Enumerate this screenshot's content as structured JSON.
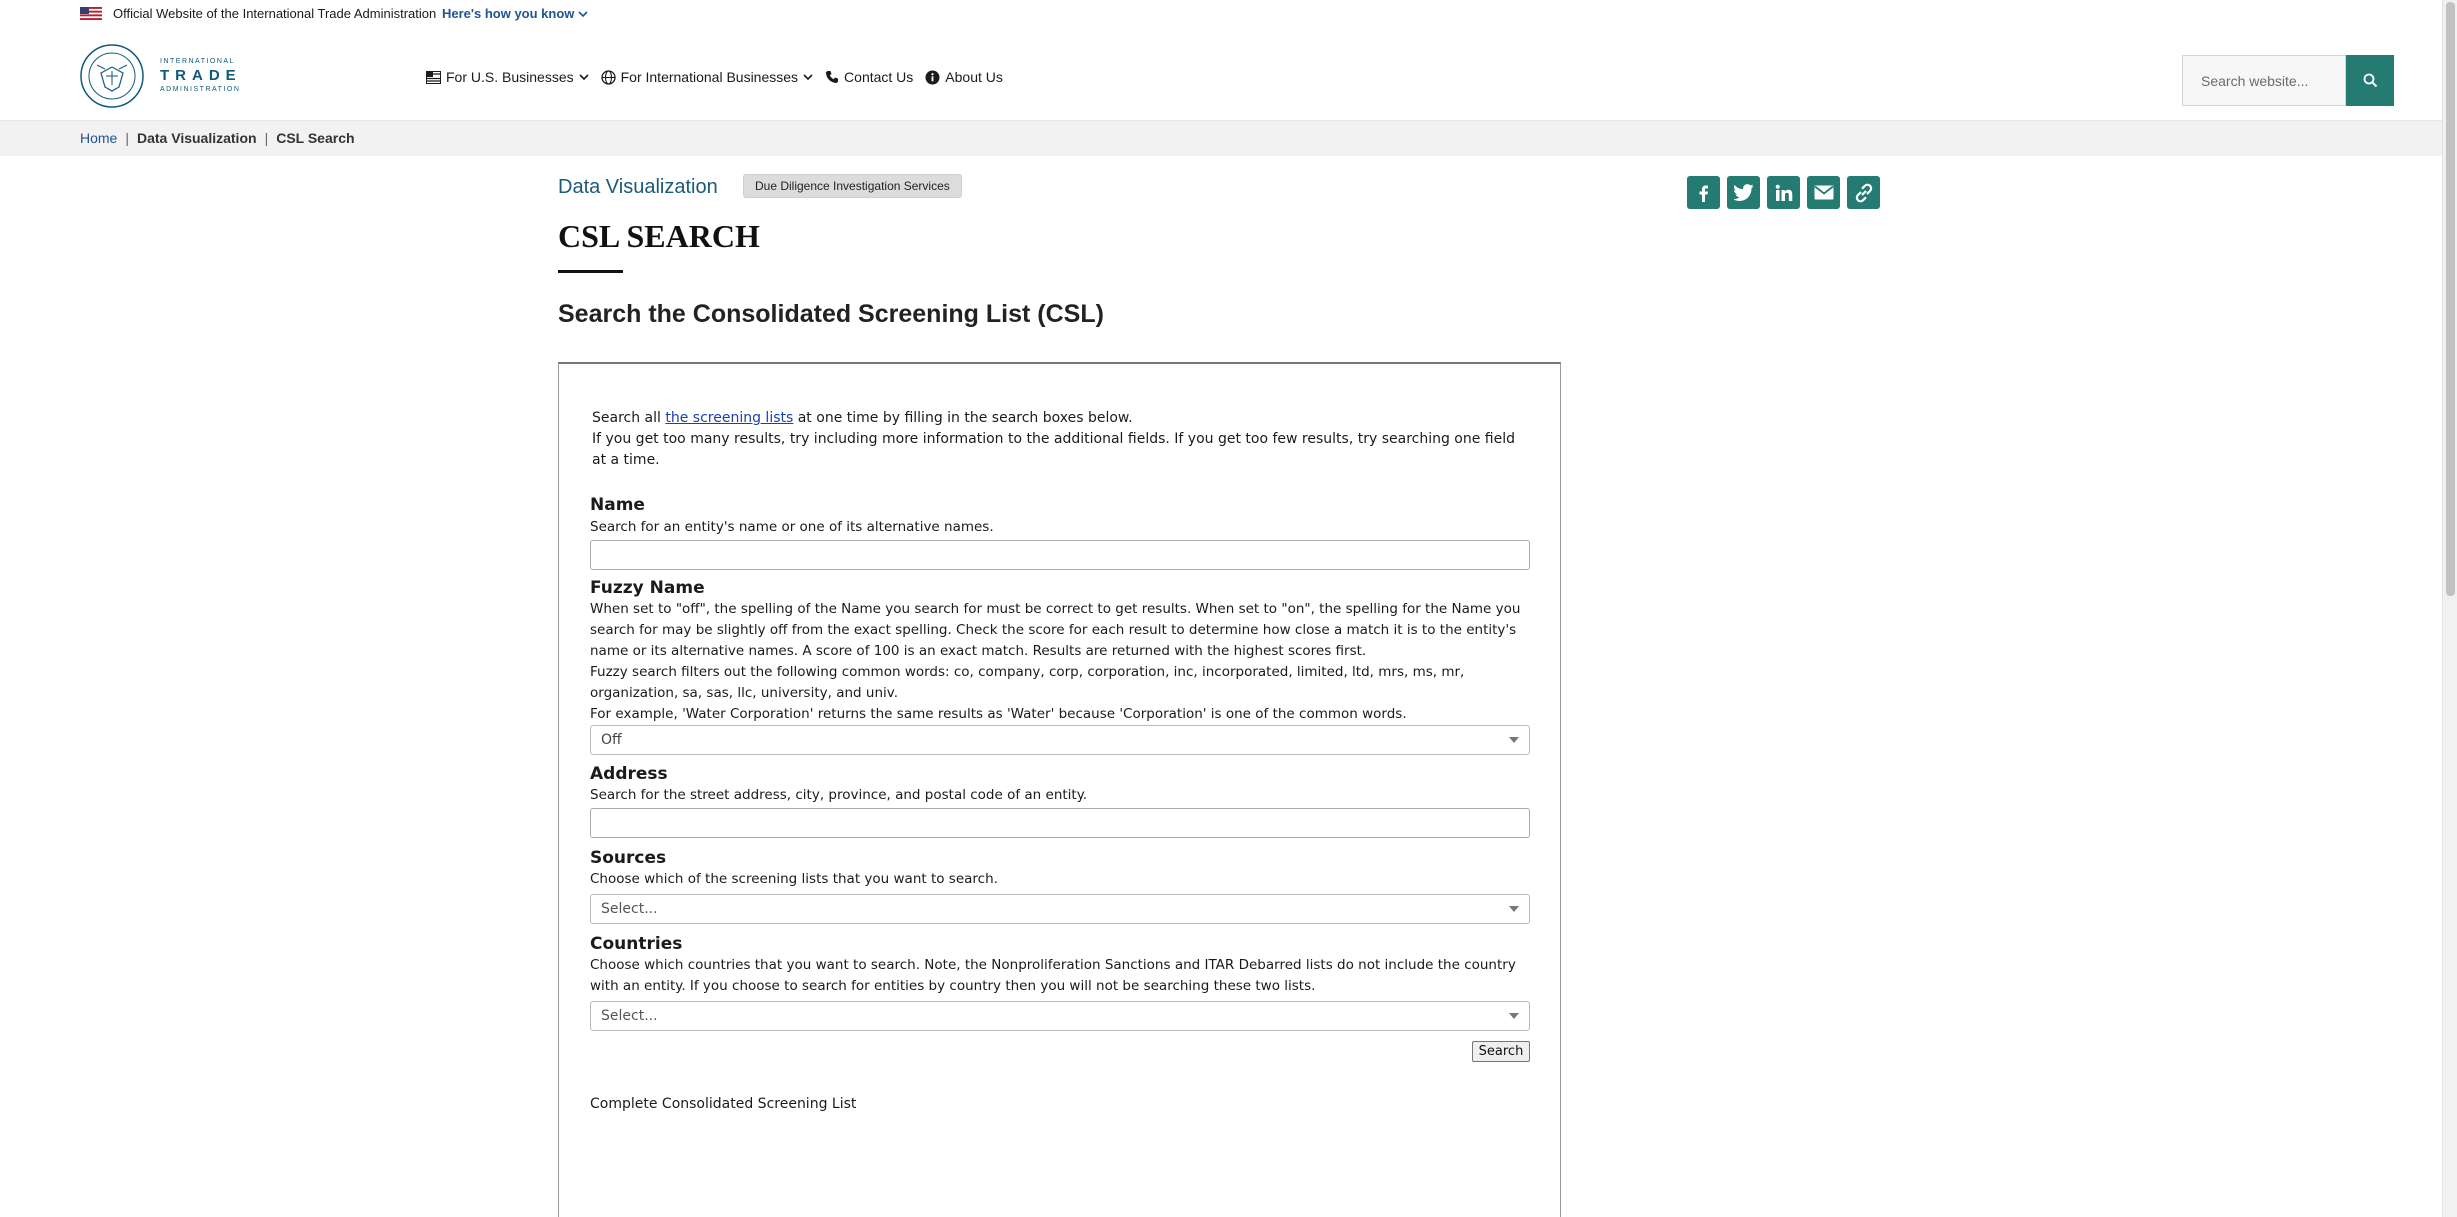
{
  "banner": {
    "official_text": "Official Website of the International Trade Administration",
    "how_you_know": "Here's how you know"
  },
  "logo": {
    "line1": "INTERNATIONAL",
    "line2": "TRADE",
    "line3": "ADMINISTRATION"
  },
  "nav": {
    "items": [
      {
        "label": "For U.S. Businesses",
        "icon": "flag-icon",
        "has_dropdown": true
      },
      {
        "label": "For International Businesses",
        "icon": "globe-icon",
        "has_dropdown": true
      },
      {
        "label": "Contact Us",
        "icon": "phone-icon",
        "has_dropdown": false
      },
      {
        "label": "About Us",
        "icon": "info-icon",
        "has_dropdown": false
      }
    ]
  },
  "search": {
    "placeholder": "Search website..."
  },
  "breadcrumb": {
    "home": "Home",
    "items": [
      "Data Visualization",
      "CSL Search"
    ]
  },
  "page": {
    "section_link": "Data Visualization",
    "tag": "Due Diligence Investigation Services",
    "title": "CSL SEARCH",
    "subtitle": "Search the Consolidated Screening List (CSL)"
  },
  "share": {
    "icons": [
      "facebook-icon",
      "twitter-icon",
      "linkedin-icon",
      "email-icon",
      "link-icon"
    ]
  },
  "form": {
    "intro_prefix": "Search all ",
    "intro_link": "the screening lists",
    "intro_suffix": " at one time by filling in the search boxes below.",
    "intro_line2": "If you get too many results, try including more information to the additional fields. If you get too few results, try searching one field at a time.",
    "name": {
      "label": "Name",
      "help": "Search for an entity's name or one of its alternative names.",
      "value": ""
    },
    "fuzzy": {
      "label": "Fuzzy Name",
      "help1": "When set to \"off\", the spelling of the Name you search for must be correct to get results. When set to \"on\", the spelling for the Name you search for may be slightly off from the exact spelling. Check the score for each result to determine how close a match it is to the entity's name or its alternative names. A score of 100 is an exact match. Results are returned with the highest scores first.",
      "help2": "Fuzzy search filters out the following common words: co, company, corp, corporation, inc, incorporated, limited, ltd, mrs, ms, mr, organization, sa, sas, llc, university, and univ.",
      "help3": "For example, 'Water Corporation' returns the same results as 'Water' because 'Corporation' is one of the common words.",
      "selected": "Off"
    },
    "address": {
      "label": "Address",
      "help": "Search for the street address, city, province, and postal code of an entity.",
      "value": ""
    },
    "sources": {
      "label": "Sources",
      "help": "Choose which of the screening lists that you want to search.",
      "placeholder": "Select..."
    },
    "countries": {
      "label": "Countries",
      "help": "Choose which countries that you want to search. Note, the Nonproliferation Sanctions and ITAR Debarred lists do not include the country with an entity. If you choose to search for entities by country then you will not be searching these two lists.",
      "placeholder": "Select..."
    },
    "search_button": "Search",
    "complete_list": "Complete Consolidated Screening List"
  },
  "colors": {
    "accent": "#237b72",
    "link": "#205493",
    "heading_link": "#1a5a7a"
  }
}
